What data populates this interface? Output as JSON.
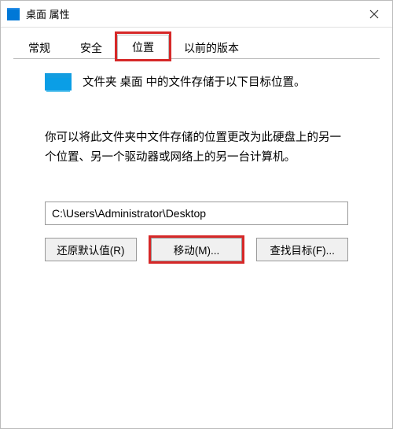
{
  "titlebar": {
    "title": "桌面 属性"
  },
  "tabs": {
    "items": [
      {
        "label": "常规"
      },
      {
        "label": "安全"
      },
      {
        "label": "位置"
      },
      {
        "label": "以前的版本"
      }
    ]
  },
  "content": {
    "info_line": "文件夹 桌面 中的文件存储于以下目标位置。",
    "description": "你可以将此文件夹中文件存储的位置更改为此硬盘上的另一个位置、另一个驱动器或网络上的另一台计算机。",
    "path_value": "C:\\Users\\Administrator\\Desktop"
  },
  "buttons": {
    "restore": "还原默认值(R)",
    "move": "移动(M)...",
    "find_target": "查找目标(F)..."
  }
}
